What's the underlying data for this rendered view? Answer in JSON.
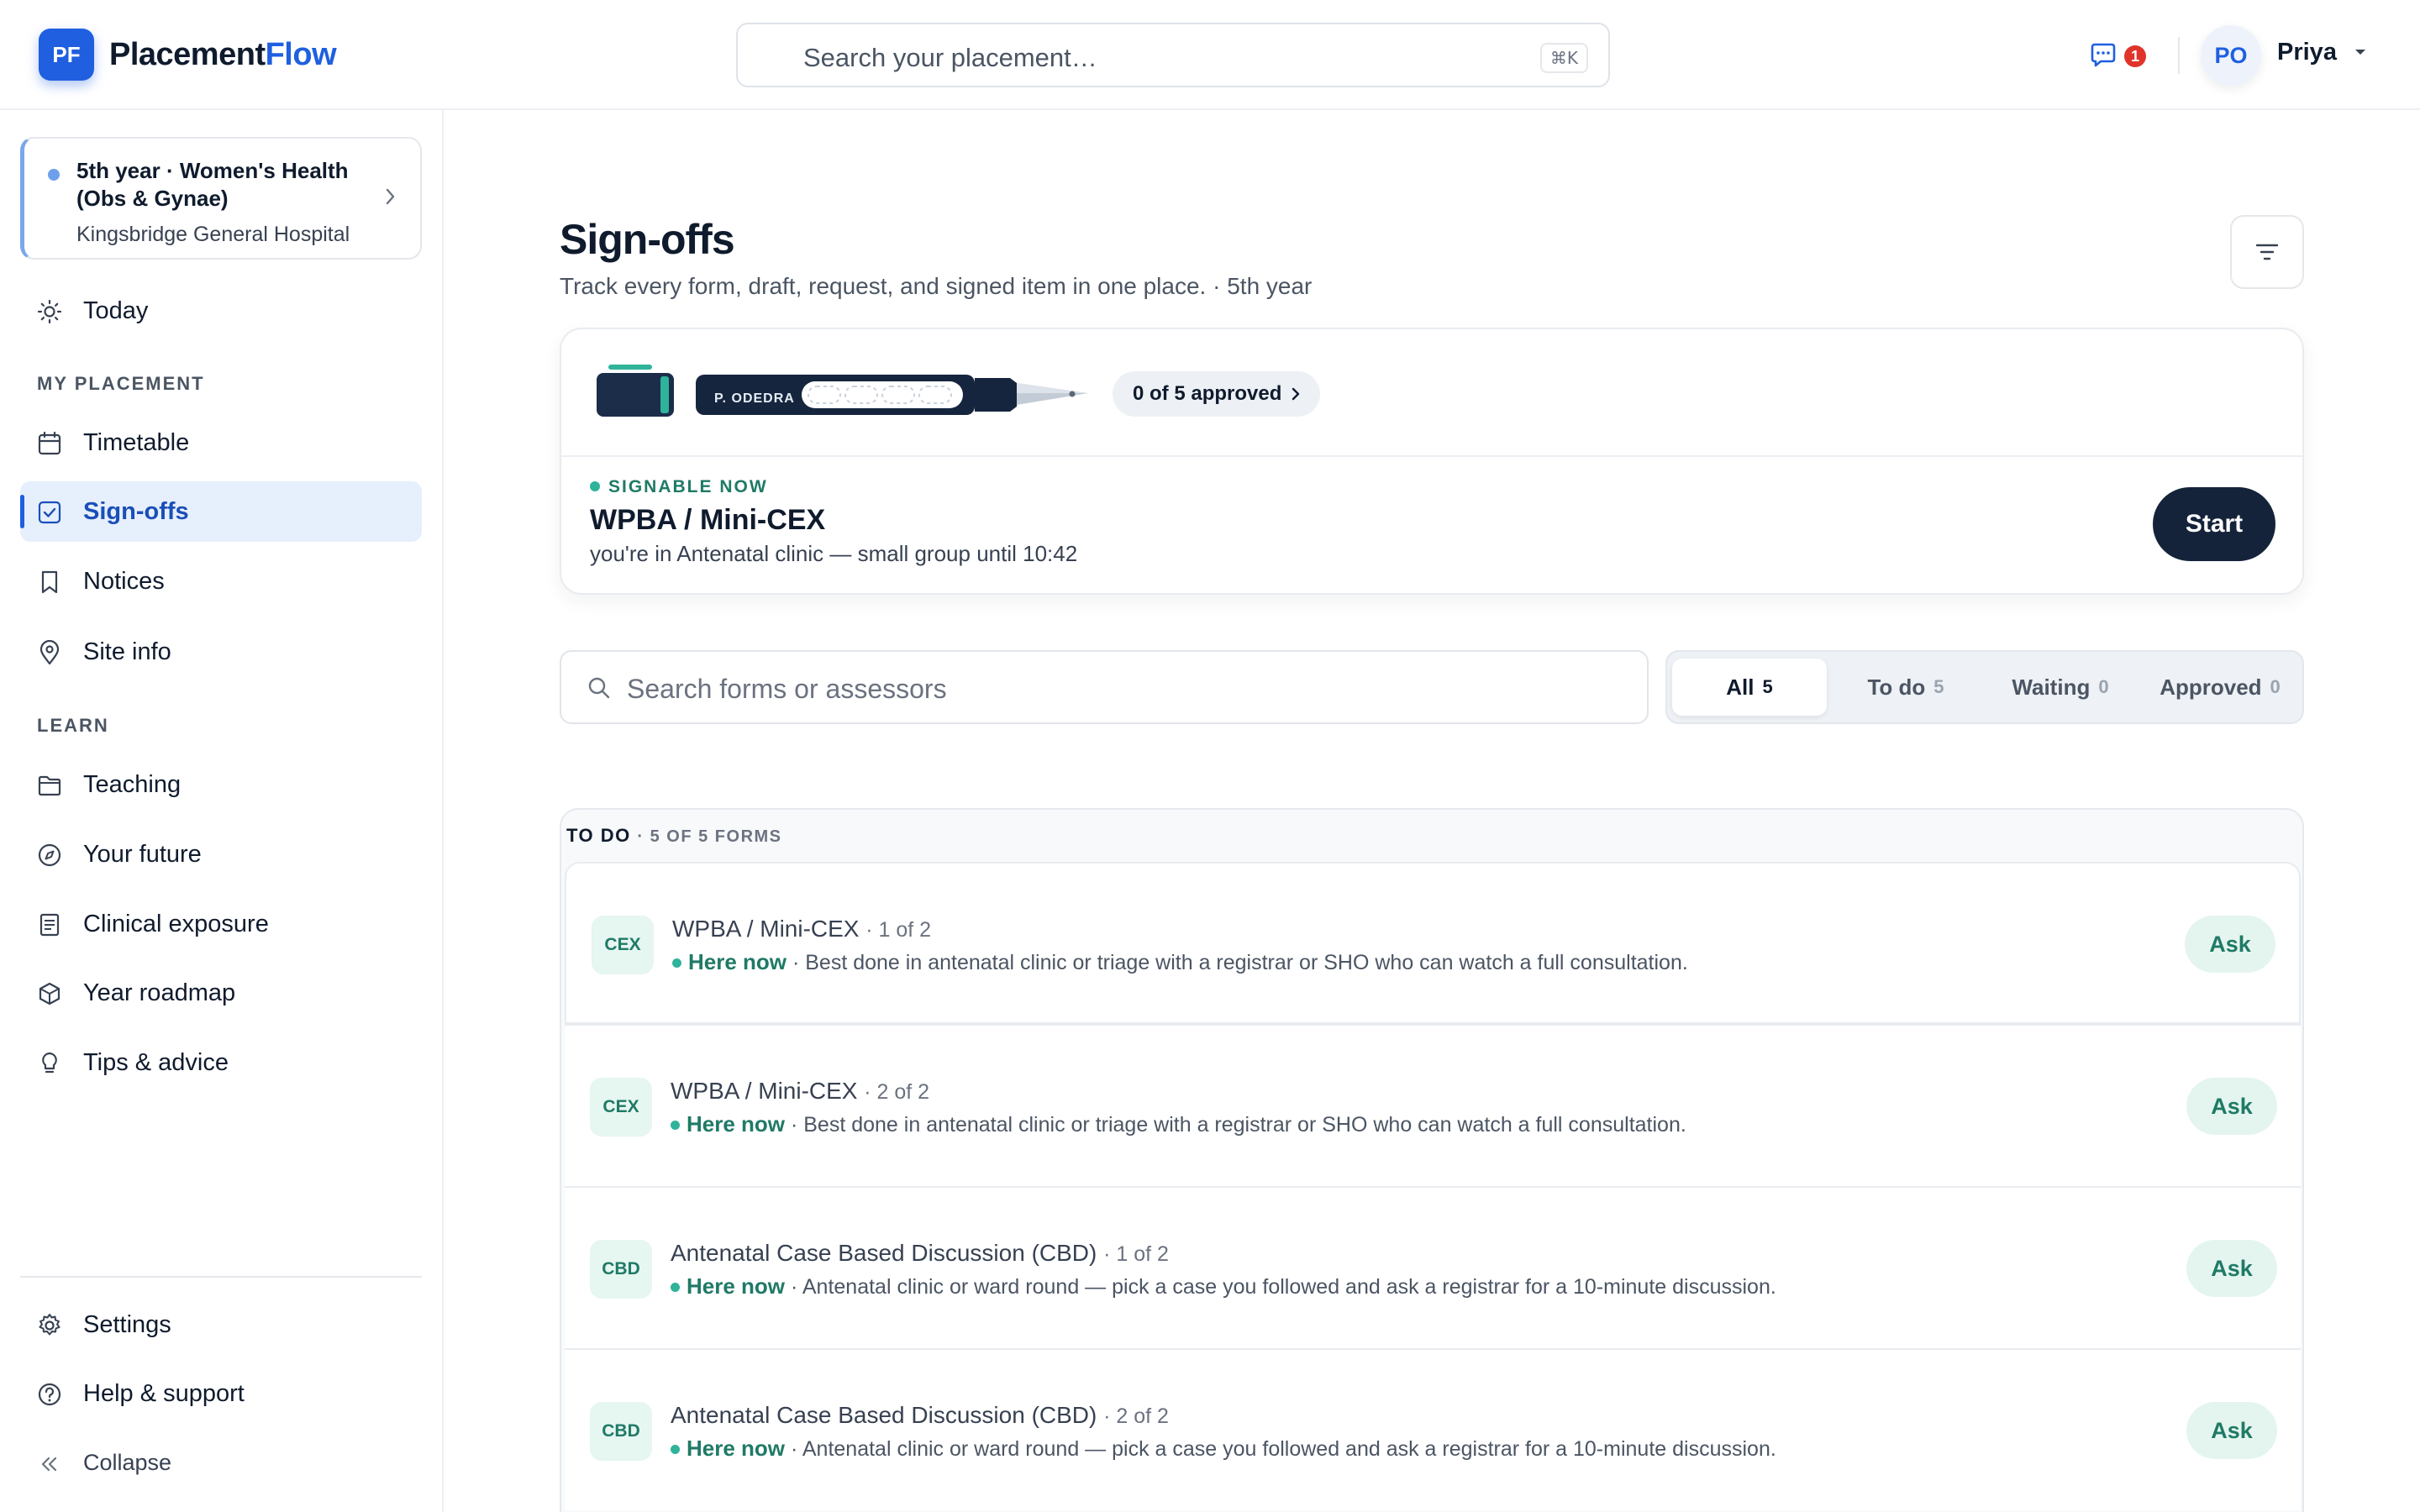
{
  "app": {
    "logo_badge": "PF",
    "name_part1": "Placement",
    "name_part2": "Flow",
    "accent": "#1f5fe0"
  },
  "header": {
    "search_placeholder": "Search your placement…",
    "search_shortcut": "⌘K",
    "messages_count": "1",
    "avatar_initials": "PO",
    "user_name": "Priya"
  },
  "sidebar": {
    "placement": {
      "title": "5th year · Women's Health (Obs & Gynae)",
      "hospital": "Kingsbridge General Hospital"
    },
    "today": "Today",
    "section_my_placement": "MY PLACEMENT",
    "my_placement_items": [
      {
        "label": "Timetable",
        "icon": "calendar-icon"
      },
      {
        "label": "Sign-offs",
        "icon": "checkbox-icon",
        "active": true
      },
      {
        "label": "Notices",
        "icon": "bookmark-icon"
      },
      {
        "label": "Site info",
        "icon": "map-pin-icon"
      }
    ],
    "section_learn": "LEARN",
    "learn_items": [
      {
        "label": "Teaching",
        "icon": "folder-icon"
      },
      {
        "label": "Your future",
        "icon": "compass-icon"
      },
      {
        "label": "Clinical exposure",
        "icon": "document-icon"
      },
      {
        "label": "Year roadmap",
        "icon": "cube-icon"
      },
      {
        "label": "Tips & advice",
        "icon": "lightbulb-icon"
      }
    ],
    "settings": "Settings",
    "help": "Help & support",
    "collapse": "Collapse"
  },
  "main": {
    "title": "Sign-offs",
    "subtitle": "Track every form, draft, request, and signed item in one place. · 5th year",
    "hero": {
      "pen_name": "P. ODEDRA",
      "approved_label": "0 of 5 approved",
      "signable_label": "SIGNABLE NOW",
      "form_title": "WPBA / Mini-CEX",
      "description": "you're in Antenatal clinic — small group until 10:42",
      "start_label": "Start"
    },
    "search_placeholder": "Search forms or assessors",
    "tabs": [
      {
        "label": "All",
        "count": "5",
        "active": true
      },
      {
        "label": "To do",
        "count": "5"
      },
      {
        "label": "Waiting",
        "count": "0"
      },
      {
        "label": "Approved",
        "count": "0"
      }
    ],
    "group": {
      "label": "TO DO",
      "count_label": "· 5 OF 5 FORMS",
      "rows": [
        {
          "abbr": "CEX",
          "title": "WPBA / Mini-CEX",
          "of": "· 1 of 2",
          "status": "Here now",
          "hint": "· Best done in antenatal clinic or triage with a registrar or SHO who can watch a full consultation.",
          "action": "Ask"
        },
        {
          "abbr": "CEX",
          "title": "WPBA / Mini-CEX",
          "of": "· 2 of 2",
          "status": "Here now",
          "hint": "· Best done in antenatal clinic or triage with a registrar or SHO who can watch a full consultation.",
          "action": "Ask"
        },
        {
          "abbr": "CBD",
          "title": "Antenatal Case Based Discussion (CBD)",
          "of": "· 1 of 2",
          "status": "Here now",
          "hint": "· Antenatal clinic or ward round — pick a case you followed and ask a registrar for a 10-minute discussion.",
          "action": "Ask"
        },
        {
          "abbr": "CBD",
          "title": "Antenatal Case Based Discussion (CBD)",
          "of": "· 2 of 2",
          "status": "Here now",
          "hint": "· Antenatal clinic or ward round — pick a case you followed and ask a registrar for a 10-minute discussion.",
          "action": "Ask"
        }
      ]
    }
  }
}
